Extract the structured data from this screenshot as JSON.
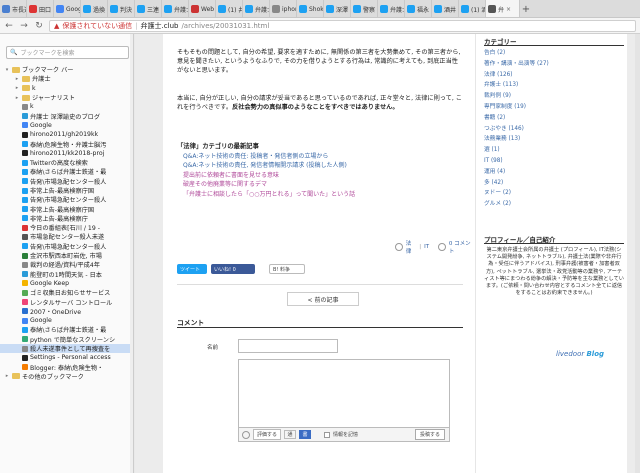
{
  "tabs": [
    {
      "label": "市長選",
      "color": "#4a7fd0"
    },
    {
      "label": "田口",
      "color": "#d33"
    },
    {
      "label": "Google",
      "color": "#4285f4"
    },
    {
      "label": "過換",
      "color": "#1da1f2"
    },
    {
      "label": "判決",
      "color": "#1da1f2"
    },
    {
      "label": "三連",
      "color": "#1da1f2"
    },
    {
      "label": "弁護士",
      "color": "#1da1f2"
    },
    {
      "label": "Web",
      "color": "#c33"
    },
    {
      "label": "(1) 井",
      "color": "#1da1f2"
    },
    {
      "label": "弁護士",
      "color": "#1da1f2"
    },
    {
      "label": "iphone",
      "color": "#888"
    },
    {
      "label": "Shoku",
      "color": "#1da1f2"
    },
    {
      "label": "深澤",
      "color": "#1da1f2"
    },
    {
      "label": "警察",
      "color": "#1da1f2"
    },
    {
      "label": "弁護士",
      "color": "#1da1f2"
    },
    {
      "label": "福永",
      "color": "#1da1f2"
    },
    {
      "label": "酒井",
      "color": "#1da1f2"
    },
    {
      "label": "(1) 酒",
      "color": "#1da1f2"
    },
    {
      "label": "弁",
      "color": "#555",
      "active": true
    }
  ],
  "address": {
    "warning": "保護されていない通信",
    "host": "弁護士.club",
    "path": "/archives/20031031.html"
  },
  "bookmarks": {
    "search_placeholder": "ブックマークを検索",
    "items": [
      {
        "label": "ブックマーク バー",
        "type": "folder",
        "depth": 0,
        "arrow": "▾"
      },
      {
        "label": "弁護士",
        "type": "folder",
        "depth": 1,
        "arrow": "▸"
      },
      {
        "label": "k",
        "type": "folder",
        "depth": 1,
        "arrow": "▸"
      },
      {
        "label": "ジャーナリスト",
        "type": "folder",
        "depth": 1,
        "arrow": "▸"
      },
      {
        "label": "k",
        "type": "bm",
        "depth": 1,
        "color": "#888"
      },
      {
        "label": "弁護士 深澤諭史のブログ",
        "type": "bm",
        "depth": 1,
        "color": "#2a9bd8"
      },
      {
        "label": "Google",
        "type": "bm",
        "depth": 1,
        "color": "#4285f4"
      },
      {
        "label": "hirono2011/gh2019kk",
        "type": "bm",
        "depth": 1,
        "color": "#222"
      },
      {
        "label": "泰納\\危険生物・弁護士脳汚",
        "type": "bm",
        "depth": 1,
        "color": "#1da1f2"
      },
      {
        "label": "hirono2011/kk2018-proj",
        "type": "bm",
        "depth": 1,
        "color": "#222"
      },
      {
        "label": "Twitterの高度な検索",
        "type": "bm",
        "depth": 1,
        "color": "#1da1f2"
      },
      {
        "label": "泰納\\さらば弁護士鉄道・最",
        "type": "bm",
        "depth": 1,
        "color": "#1da1f2"
      },
      {
        "label": "告発\\市場急配センター殺人",
        "type": "bm",
        "depth": 1,
        "color": "#1da1f2"
      },
      {
        "label": "非常上告-最高検察庁国",
        "type": "bm",
        "depth": 1,
        "color": "#1da1f2"
      },
      {
        "label": "告発\\市場急配センター殺人",
        "type": "bm",
        "depth": 1,
        "color": "#1da1f2"
      },
      {
        "label": "非常上告-最高検察庁国",
        "type": "bm",
        "depth": 1,
        "color": "#1da1f2"
      },
      {
        "label": "非常上告-最高検察庁",
        "type": "bm",
        "depth": 1,
        "color": "#1da1f2"
      },
      {
        "label": "今日の番組表[石川 / 19 -",
        "type": "bm",
        "depth": 1,
        "color": "#d33"
      },
      {
        "label": "市場急配センター殺人未遂",
        "type": "bm",
        "depth": 1,
        "color": "#555"
      },
      {
        "label": "告発\\市場急配センター殺人",
        "type": "bm",
        "depth": 1,
        "color": "#1da1f2"
      },
      {
        "label": "金沢市駅西本町岩佐, 市場",
        "type": "bm",
        "depth": 1,
        "color": "#2a7f3a"
      },
      {
        "label": "裁判の経過/資料/平成4年",
        "type": "bm",
        "depth": 1,
        "color": "#888"
      },
      {
        "label": "能登町の1時間天気 - 日本",
        "type": "bm",
        "depth": 1,
        "color": "#2a9bd8"
      },
      {
        "label": "Google Keep",
        "type": "bm",
        "depth": 1,
        "color": "#f4b400"
      },
      {
        "label": "ゴミ収集日お知らせサービス",
        "type": "bm",
        "depth": 1,
        "color": "#5a5"
      },
      {
        "label": "レンタルサーバ コントロール",
        "type": "bm",
        "depth": 1,
        "color": "#e47"
      },
      {
        "label": "2007・OneDrive",
        "type": "bm",
        "depth": 1,
        "color": "#2a6fd0"
      },
      {
        "label": "Google",
        "type": "bm",
        "depth": 1,
        "color": "#4285f4"
      },
      {
        "label": "泰納\\さらば弁護士鉄道・最",
        "type": "bm",
        "depth": 1,
        "color": "#1da1f2"
      },
      {
        "label": "python で簡単なスクリーンシ",
        "type": "bm",
        "depth": 1,
        "color": "#3a7"
      },
      {
        "label": "殺人未遂事件として再捜査を",
        "type": "bm",
        "depth": 1,
        "color": "#888",
        "selected": true
      },
      {
        "label": "Settings - Personal access",
        "type": "bm",
        "depth": 1,
        "color": "#222"
      },
      {
        "label": "Blogger: 泰納\\危険生物・",
        "type": "bm",
        "depth": 1,
        "color": "#f57c00"
      },
      {
        "label": "その他のブックマーク",
        "type": "folder",
        "depth": 0,
        "arrow": "▸"
      }
    ]
  },
  "article": {
    "para1": "そもそもの問題として, 自分の希望, 要求を適すために, 無関係の第三者を大勢集めて, その第三者から, 意見を聞きたい, というようなふりで, その力を借りようとする行為は, 常識的に考えても, 到底正当性がないと思います。",
    "para2": "本当に, 自分が正しい, 自分の請求が妥当であると思っているのであれば, 正々堂々と, 法律に則って, これを行うべきです。",
    "para2_bold": "反社会勢力の真似事のようなことをすべきではありません。",
    "category_title": "「法律」カテゴリの最新記事",
    "related": [
      {
        "text": "Q&A:ネット技術の責任: 投稿者・発信者側の立場から",
        "color": "#3b6aa8"
      },
      {
        "text": "Q&A:ネット技術の責任, 発信者情報開示請求 (投稿した人側)",
        "color": "#3b6aa8"
      },
      {
        "text": "提出前に依頼者に書面を見せる意味",
        "color": "#b04a9a"
      },
      {
        "text": "破産その他廃業等に関するデマ",
        "color": "#b04a9a"
      },
      {
        "text": "「弁護士に相談したら「○○万円とれる」って聞いた」という話",
        "color": "#b04a9a"
      }
    ],
    "meta_category": "法律",
    "meta_tag": "IT",
    "meta_comments": "0 コメント",
    "tweet": "ツイート",
    "like": "いいね! 0",
    "hatena": "B! 料争",
    "prev": "< 前の記事"
  },
  "comment": {
    "title": "コメント",
    "name_label": "名前",
    "rating": "評価する",
    "toggle_off": "通",
    "toggle_on": "書",
    "remember": "情報を記憶",
    "submit": "投稿する"
  },
  "right": {
    "categories_title": "カテゴリー",
    "categories": [
      "告白 (2)",
      "著作・講演・出演等 (27)",
      "法律 (126)",
      "弁護士 (113)",
      "裁判例 (9)",
      "専門家制度 (19)",
      "書籍 (2)",
      "つぶやき (146)",
      "法務業務 (13)",
      "選 (1)",
      "IT (98)",
      "運用 (4)",
      "多 (42)",
      "ヌドー (2)",
      "グルメ (2)"
    ],
    "profile_title": "プロフィール／自己紹介",
    "profile_link": "プロフィール",
    "profile_text": "第二東京弁護士会所属の弁護士 (プロフィール), IT法務(システム開発紛争, ネットトラブル), 弁護士法(業際や非弁行為・受任に伴うアドバイス), 刑事弁護(被害者・加害者双方), ペットトラブル, 選挙法・政党活動等の業務や, アーティスト等にまつわる紛争の解決・予防等を主な業務としています。(ご依頼・問い合わせ内容とするコメント全てに返信をすることはお約束できません。)",
    "logo_a": "livedoor",
    "logo_b": "Blog"
  }
}
